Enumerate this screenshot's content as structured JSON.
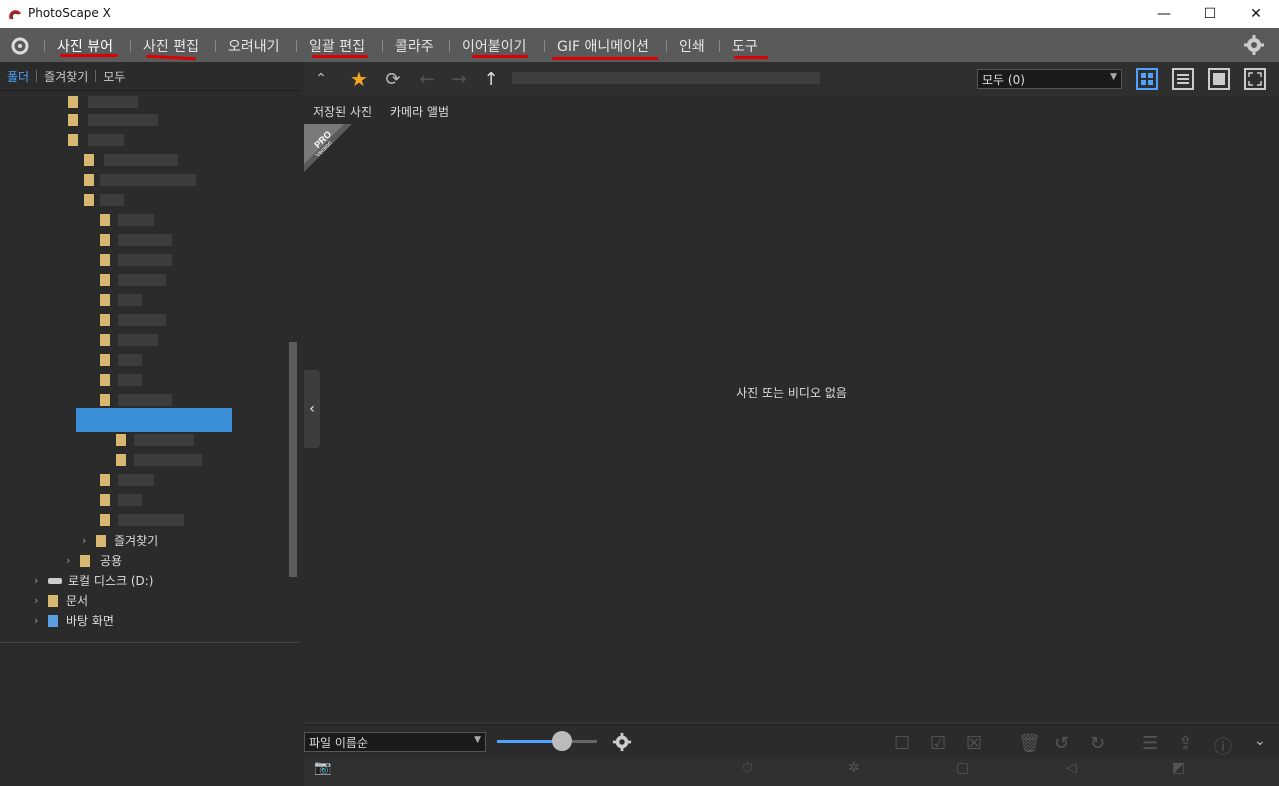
{
  "window": {
    "title": "PhotoScape X"
  },
  "menu": {
    "tabs": [
      "사진 뷰어",
      "사진 편집",
      "오려내기",
      "일괄 편집",
      "콜라주",
      "이어붙이기",
      "GIF 애니메이션",
      "인쇄",
      "도구"
    ]
  },
  "left": {
    "tabs": [
      "폴더",
      "즐겨찾기",
      "모두"
    ],
    "tree": [
      {
        "label": "즐겨찾기"
      },
      {
        "label": "공용"
      },
      {
        "label": "로컬 디스크 (D:)"
      },
      {
        "label": "문서"
      },
      {
        "label": "바탕 화면"
      }
    ]
  },
  "toolbar": {
    "filter": "모두 (0)"
  },
  "subtabs": [
    "저장된 사진",
    "카메라 앨범"
  ],
  "badge": {
    "line1": "PRO",
    "line2": "Version"
  },
  "main": {
    "empty": "사진 또는 비디오 없음"
  },
  "bottom": {
    "sort": "파일 이름순",
    "zoom": 0.65
  },
  "colors": {
    "accent": "#4fa3ff",
    "star": "#f5a623",
    "selection": "#3a8fd8",
    "annotation": "#d00000"
  }
}
